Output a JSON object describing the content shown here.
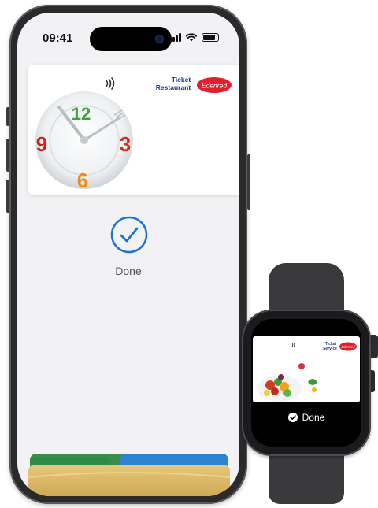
{
  "phone": {
    "status_time": "09:41",
    "card": {
      "brand_line1": "Ticket",
      "brand_line2": "Restaurant",
      "brand_badge": "Edenred",
      "clock_digits": [
        "12",
        "3",
        "6",
        "9"
      ]
    },
    "done_label": "Done",
    "colors": {
      "check": "#1e72d6",
      "badge": "#e0202b",
      "brand_blue": "#1a3a8c"
    }
  },
  "watch": {
    "card": {
      "brand_line1": "Ticket",
      "brand_line2": "Service",
      "brand_badge": "Edenred"
    },
    "done_label": "Done"
  }
}
